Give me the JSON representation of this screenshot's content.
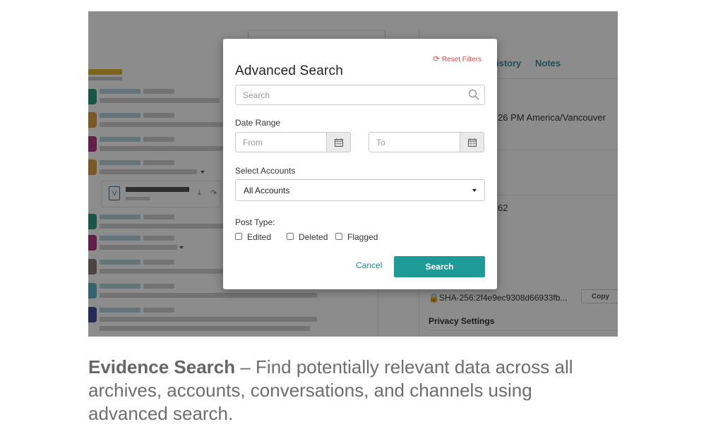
{
  "background": {
    "tabs": [
      "istory",
      "Notes"
    ],
    "detail_time": "26 PM America/Vancouver",
    "detail_num": "62",
    "hash": "SHA-256:2f4e9ec9308d66933fb...",
    "copy_label": "Copy",
    "privacy_settings": "Privacy Settings"
  },
  "modal": {
    "reset_label": "Reset Filters",
    "title": "Advanced Search",
    "search_placeholder": "Search",
    "date_range_label": "Date Range",
    "from_placeholder": "From",
    "to_placeholder": "To",
    "select_accounts_label": "Select Accounts",
    "accounts_selected": "All Accounts",
    "post_type_label": "Post Type:",
    "post_types": [
      "Edited",
      "Deleted",
      "Flagged"
    ],
    "cancel_label": "Cancel",
    "search_button": "Search"
  },
  "caption": {
    "bold": "Evidence Search",
    "text": " – Find potentially relevant data across all archives, accounts, conversations, and channels using advanced search."
  },
  "colors": {
    "accent": "#1e9b96",
    "reset": "#d34a4a",
    "tab": "#3b8ea5"
  }
}
